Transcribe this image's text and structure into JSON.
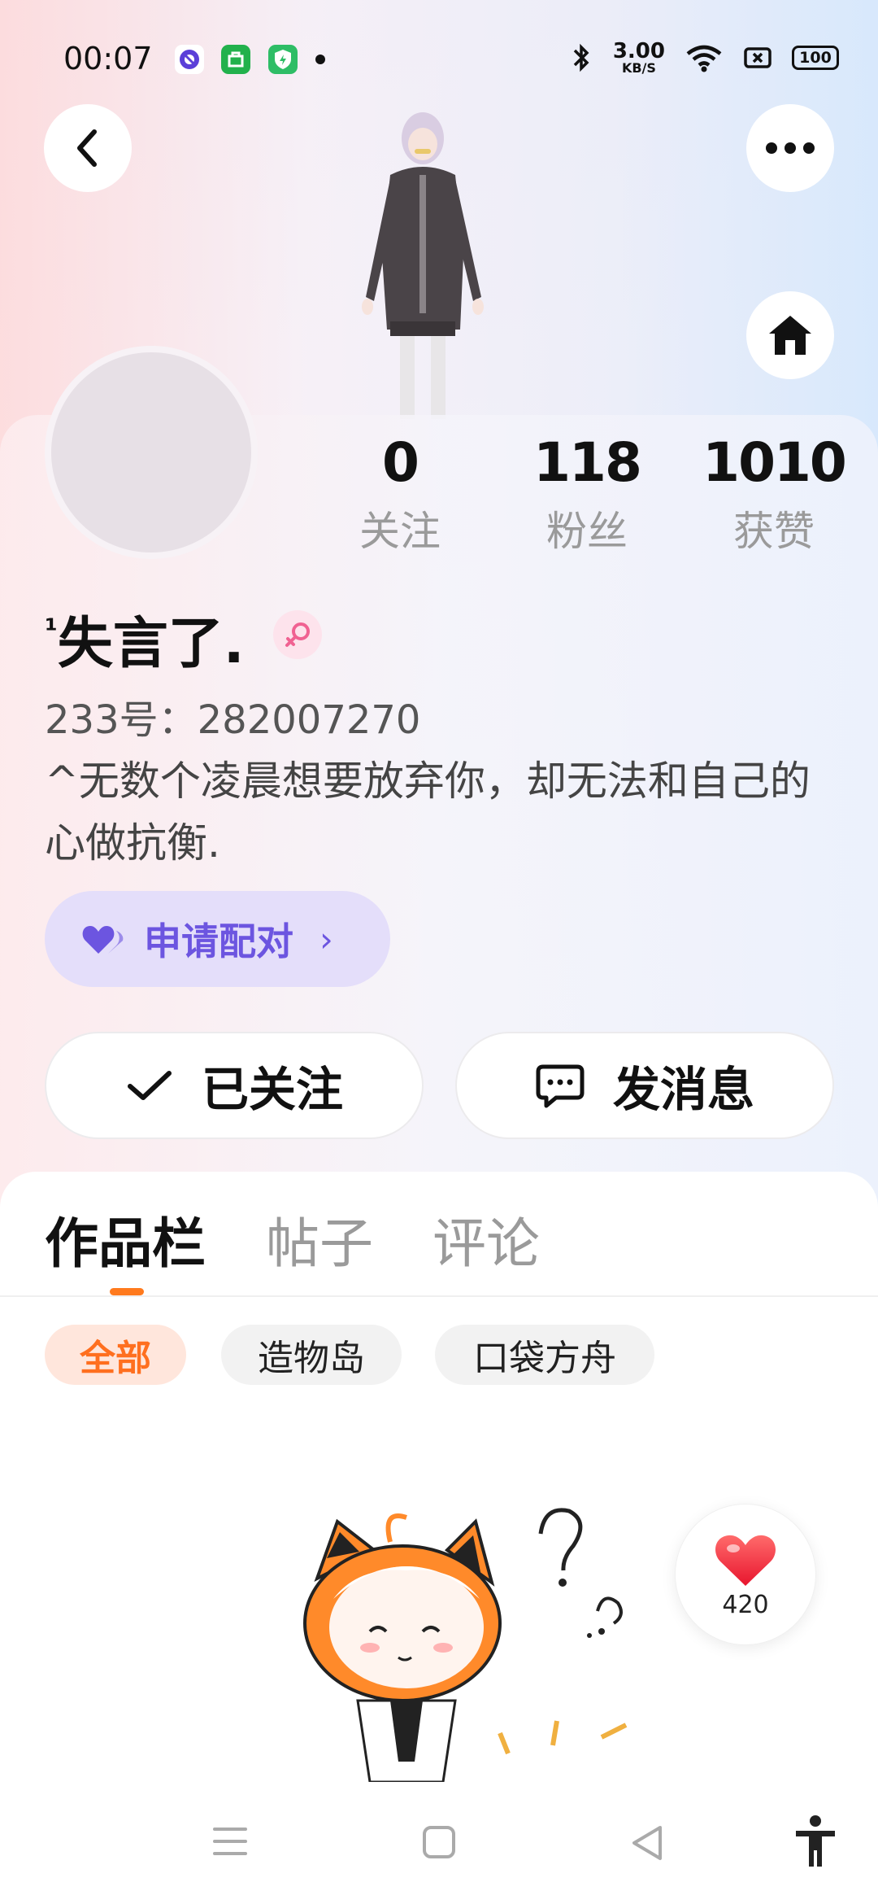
{
  "status_bar": {
    "time": "00:07",
    "net_speed_value": "3.00",
    "net_speed_unit": "KB/S",
    "battery": "100",
    "icons": [
      "app-purple-icon",
      "app-green-icon",
      "app-shield-icon",
      "dot-icon",
      "bluetooth-icon",
      "wifi-icon",
      "screen-record-icon",
      "battery-icon"
    ]
  },
  "header": {
    "back_icon": "back-arrow-icon",
    "more_icon": "more-icon",
    "home_icon": "home-icon"
  },
  "profile": {
    "name_prefix": "¹",
    "name": "失言了.",
    "gender_icon": "female-icon",
    "uid": "233号：282007270",
    "bio": "^无数个凌晨想要放弃你，却无法和自己的心做抗衡."
  },
  "stats": [
    {
      "value": "0",
      "label": "关注"
    },
    {
      "value": "118",
      "label": "粉丝"
    },
    {
      "value": "1010",
      "label": "获赞"
    }
  ],
  "pair_button": {
    "label": "申请配对",
    "chevron": "›"
  },
  "actions": {
    "follow_label": "已关注",
    "message_label": "发消息"
  },
  "tabs": [
    {
      "label": "作品栏",
      "active": true
    },
    {
      "label": "帖子",
      "active": false
    },
    {
      "label": "评论",
      "active": false
    }
  ],
  "filters": [
    {
      "label": "全部",
      "active": true
    },
    {
      "label": "造物岛",
      "active": false
    },
    {
      "label": "口袋方舟",
      "active": false
    }
  ],
  "like_fab": {
    "count": "420"
  },
  "colors": {
    "accent": "#ff7a1e",
    "pair": "#6c55e0",
    "pair_bg": "#e4defa",
    "like": "#f53a4a"
  }
}
